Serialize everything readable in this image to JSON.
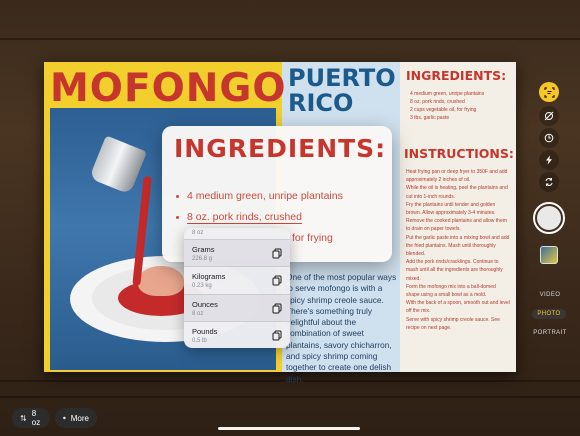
{
  "recipe": {
    "title_left": "MOFONGO",
    "title_right_line1": "PUERTO",
    "title_right_line2": "RICO",
    "ingredients_heading": "INGREDIENTS:",
    "instructions_heading": "INSTRUCTIONS:",
    "ingredients_small": [
      "4 medium green, unripe plantains",
      "8 oz. pork rinds, crushed",
      "2 cups vegetable oil, for frying",
      "3 tbs. garlic paste"
    ],
    "instructions_small": [
      "Heat frying pan or deep fryer to 350F and add approximately 2 inches of oil.",
      "While the oil is heating, peel the plantains and cut into 1-inch rounds.",
      "Fry the plantains until tender and golden brown. Allow approximately 3-4 minutes.",
      "Remove the cooked plantains and allow them to drain on paper towels.",
      "Put the garlic paste into a mixing bowl and add the fried plantains. Mash until thoroughly blended.",
      "Add the pork rinds/cracklings. Continue to mash until all the ingredients are thoroughly mixed.",
      "Form the mofongo mix into a ball-domed shape using a small bowl as a mold.",
      "With the back of a spoon, smooth out and level off the mix.",
      "Serve with spicy shrimp creole sauce. See recipe on next page."
    ],
    "body_text": "One of the most popular ways to serve mofongo is with a spicy shrimp creole sauce. There's something truly delightful about the combination of sweet plantains, savory chicharron, and spicy shrimp coming together to create one delish dish."
  },
  "live_text_card": {
    "heading": "INGREDIENTS:",
    "items": [
      "4 medium green, unripe plantains",
      "8 oz. pork rinds, crushed",
      "for frying",
      ""
    ]
  },
  "conversion": {
    "header": "8 oz",
    "rows": [
      {
        "label": "Grams",
        "value": "226.8 g"
      },
      {
        "label": "Kilograms",
        "value": "0.23 kg"
      },
      {
        "label": "Ounces",
        "value": "8 oz"
      },
      {
        "label": "Pounds",
        "value": "0.5 lb"
      }
    ]
  },
  "camera": {
    "modes": [
      "VIDEO",
      "PHOTO",
      "PORTRAIT"
    ],
    "active_mode": "PHOTO",
    "icons": [
      "live-text-icon",
      "scan-icon",
      "timer-icon",
      "flash-icon",
      "switch-camera-icon"
    ]
  },
  "bottom_bar": {
    "units_label": "8 oz",
    "more_label": "More"
  },
  "colors": {
    "recipe_red": "#c6362c",
    "recipe_blue": "#1d5a8c",
    "accent_yellow": "#f7c629"
  }
}
